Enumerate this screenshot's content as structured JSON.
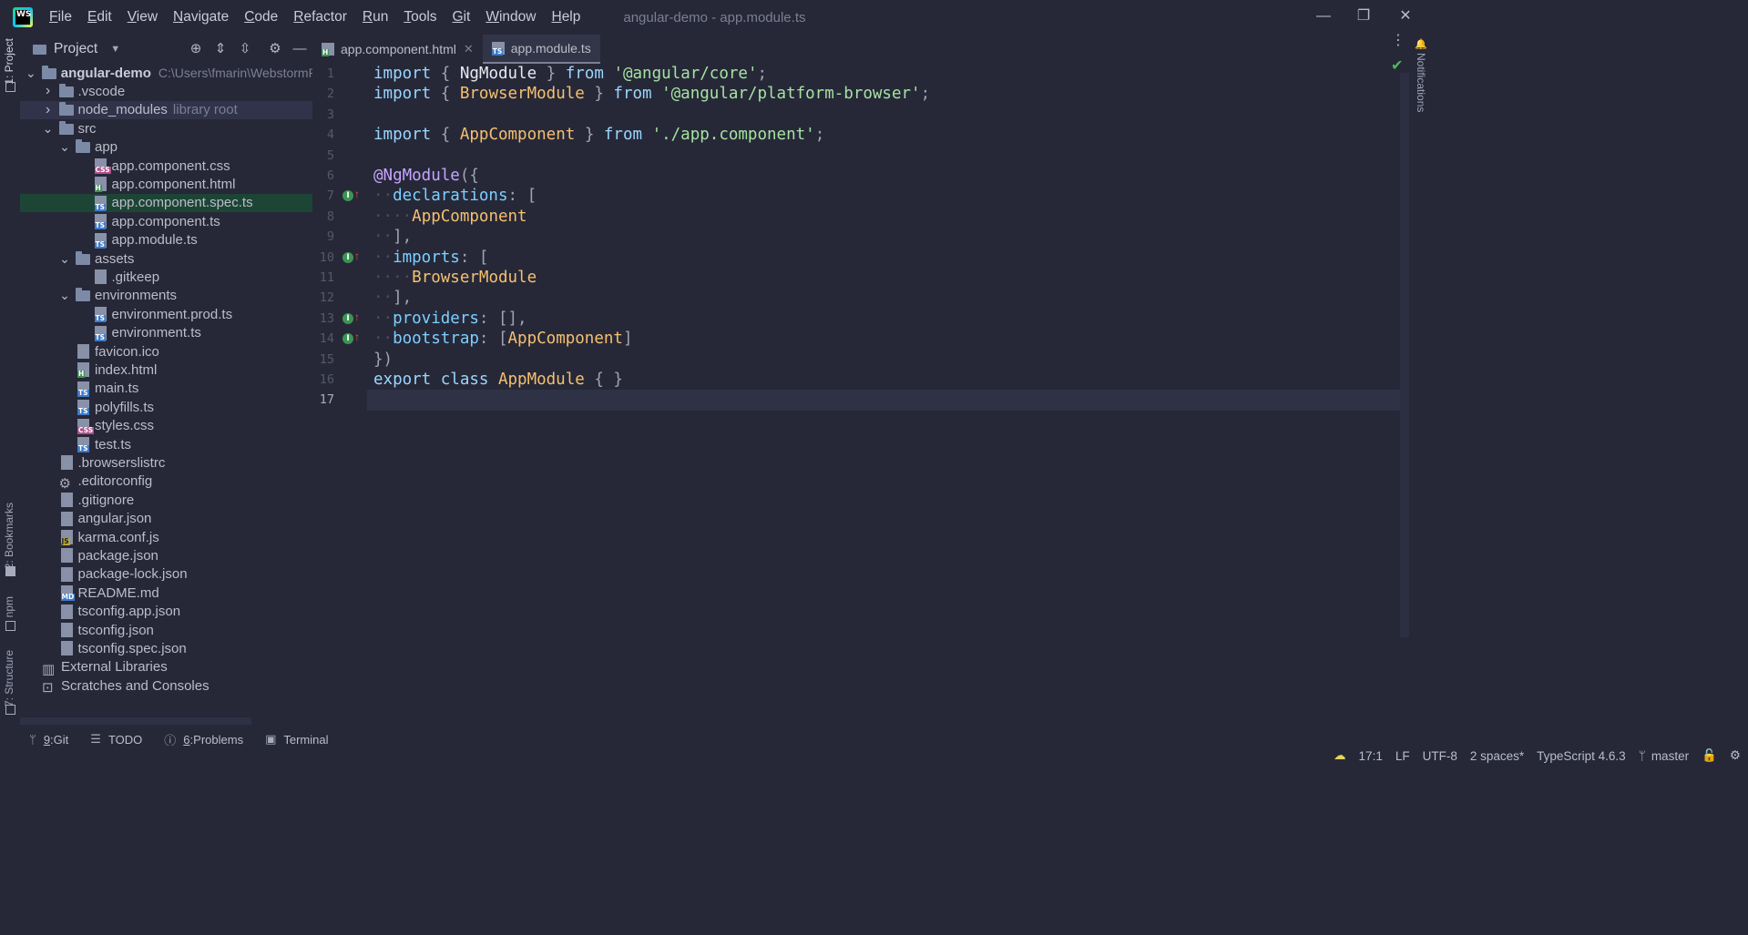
{
  "app": {
    "logo_text": "WS",
    "window_title": "angular-demo - app.module.ts"
  },
  "menu": [
    {
      "label": "File"
    },
    {
      "label": "Edit"
    },
    {
      "label": "View"
    },
    {
      "label": "Navigate"
    },
    {
      "label": "Code"
    },
    {
      "label": "Refactor"
    },
    {
      "label": "Run"
    },
    {
      "label": "Tools"
    },
    {
      "label": "Git"
    },
    {
      "label": "Window"
    },
    {
      "label": "Help"
    }
  ],
  "left_strip": {
    "project": "1: Project",
    "bookmarks": "2: Bookmarks",
    "npm": "npm",
    "structure": "7: Structure"
  },
  "right_strip": {
    "notifications": "Notifications"
  },
  "project_panel": {
    "title": "Project",
    "tree": [
      {
        "label": "angular-demo",
        "extra": "C:\\Users\\fmarin\\WebstormProjects\\",
        "depth": 0,
        "kind": "folder",
        "expanded": true,
        "bold": true
      },
      {
        "label": ".vscode",
        "depth": 1,
        "kind": "folder",
        "expanded": false
      },
      {
        "label": "node_modules",
        "extra": "library root",
        "depth": 1,
        "kind": "folder",
        "expanded": false,
        "highlight": "gray"
      },
      {
        "label": "src",
        "depth": 1,
        "kind": "folder",
        "expanded": true
      },
      {
        "label": "app",
        "depth": 2,
        "kind": "folder",
        "expanded": true
      },
      {
        "label": "app.component.css",
        "depth": 3,
        "kind": "file",
        "badge": "CSS"
      },
      {
        "label": "app.component.html",
        "depth": 3,
        "kind": "file",
        "badge": "H"
      },
      {
        "label": "app.component.spec.ts",
        "depth": 3,
        "kind": "file",
        "badge": "TS",
        "highlight": "green"
      },
      {
        "label": "app.component.ts",
        "depth": 3,
        "kind": "file",
        "badge": "TS"
      },
      {
        "label": "app.module.ts",
        "depth": 3,
        "kind": "file",
        "badge": "TS"
      },
      {
        "label": "assets",
        "depth": 2,
        "kind": "folder",
        "expanded": true
      },
      {
        "label": ".gitkeep",
        "depth": 3,
        "kind": "file",
        "badge": ""
      },
      {
        "label": "environments",
        "depth": 2,
        "kind": "folder",
        "expanded": true
      },
      {
        "label": "environment.prod.ts",
        "depth": 3,
        "kind": "file",
        "badge": "TS"
      },
      {
        "label": "environment.ts",
        "depth": 3,
        "kind": "file",
        "badge": "TS"
      },
      {
        "label": "favicon.ico",
        "depth": 2,
        "kind": "file",
        "badge": ""
      },
      {
        "label": "index.html",
        "depth": 2,
        "kind": "file",
        "badge": "H"
      },
      {
        "label": "main.ts",
        "depth": 2,
        "kind": "file",
        "badge": "TS"
      },
      {
        "label": "polyfills.ts",
        "depth": 2,
        "kind": "file",
        "badge": "TS"
      },
      {
        "label": "styles.css",
        "depth": 2,
        "kind": "file",
        "badge": "CSS"
      },
      {
        "label": "test.ts",
        "depth": 2,
        "kind": "file",
        "badge": "TS"
      },
      {
        "label": ".browserslistrc",
        "depth": 1,
        "kind": "file",
        "badge": ""
      },
      {
        "label": ".editorconfig",
        "depth": 1,
        "kind": "gear",
        "badge": ""
      },
      {
        "label": ".gitignore",
        "depth": 1,
        "kind": "file",
        "badge": ""
      },
      {
        "label": "angular.json",
        "depth": 1,
        "kind": "file",
        "badge": ""
      },
      {
        "label": "karma.conf.js",
        "depth": 1,
        "kind": "file",
        "badge": "JS"
      },
      {
        "label": "package.json",
        "depth": 1,
        "kind": "file",
        "badge": ""
      },
      {
        "label": "package-lock.json",
        "depth": 1,
        "kind": "file",
        "badge": ""
      },
      {
        "label": "README.md",
        "depth": 1,
        "kind": "file",
        "badge": "MD"
      },
      {
        "label": "tsconfig.app.json",
        "depth": 1,
        "kind": "file",
        "badge": ""
      },
      {
        "label": "tsconfig.json",
        "depth": 1,
        "kind": "file",
        "badge": ""
      },
      {
        "label": "tsconfig.spec.json",
        "depth": 1,
        "kind": "file",
        "badge": ""
      },
      {
        "label": "External Libraries",
        "depth": 0,
        "kind": "libs",
        "expanded": false
      },
      {
        "label": "Scratches and Consoles",
        "depth": 0,
        "kind": "scratch",
        "expanded": false
      }
    ]
  },
  "editor": {
    "tabs": [
      {
        "label": "app.component.html",
        "badge": "H",
        "active": false
      },
      {
        "label": "app.module.ts",
        "badge": "TS",
        "active": true
      }
    ],
    "lines": [
      [
        [
          "kw",
          "import "
        ],
        [
          "pun",
          "{ "
        ],
        [
          "id",
          "NgModule"
        ],
        [
          "pun",
          " } "
        ],
        [
          "kw",
          "from "
        ],
        [
          "str",
          "'@angular/core'"
        ],
        [
          "pun",
          ";"
        ]
      ],
      [
        [
          "kw",
          "import "
        ],
        [
          "pun",
          "{ "
        ],
        [
          "cls",
          "BrowserModule"
        ],
        [
          "pun",
          " } "
        ],
        [
          "kw",
          "from "
        ],
        [
          "str",
          "'@angular/platform-browser'"
        ],
        [
          "pun",
          ";"
        ]
      ],
      [],
      [
        [
          "kw",
          "import "
        ],
        [
          "pun",
          "{ "
        ],
        [
          "cls",
          "AppComponent"
        ],
        [
          "pun",
          " } "
        ],
        [
          "kw",
          "from "
        ],
        [
          "str",
          "'./app.component'"
        ],
        [
          "pun",
          ";"
        ]
      ],
      [],
      [
        [
          "dec",
          "@NgModule"
        ],
        [
          "pun",
          "({"
        ]
      ],
      [
        [
          "dot",
          "··"
        ],
        [
          "prop",
          "declarations"
        ],
        [
          "pun",
          ": ["
        ]
      ],
      [
        [
          "dot",
          "····"
        ],
        [
          "cls",
          "AppComponent"
        ]
      ],
      [
        [
          "dot",
          "··"
        ],
        [
          "pun",
          "],"
        ]
      ],
      [
        [
          "dot",
          "··"
        ],
        [
          "prop",
          "imports"
        ],
        [
          "pun",
          ": ["
        ]
      ],
      [
        [
          "dot",
          "····"
        ],
        [
          "cls",
          "BrowserModule"
        ]
      ],
      [
        [
          "dot",
          "··"
        ],
        [
          "pun",
          "],"
        ]
      ],
      [
        [
          "dot",
          "··"
        ],
        [
          "prop",
          "providers"
        ],
        [
          "pun",
          ": [],"
        ]
      ],
      [
        [
          "dot",
          "··"
        ],
        [
          "prop",
          "bootstrap"
        ],
        [
          "pun",
          ": ["
        ],
        [
          "cls",
          "AppComponent"
        ],
        [
          "pun",
          "]"
        ]
      ],
      [
        [
          "pun",
          "})"
        ]
      ],
      [
        [
          "kw",
          "export class "
        ],
        [
          "cls",
          "AppModule"
        ],
        [
          "pun",
          " { }"
        ]
      ],
      []
    ],
    "line_numbers": [
      "1",
      "2",
      "3",
      "4",
      "5",
      "6",
      "7",
      "8",
      "9",
      "10",
      "11",
      "12",
      "13",
      "14",
      "15",
      "16",
      "17"
    ],
    "current_line": 17,
    "gutter_marks": [
      7,
      10,
      13,
      14
    ],
    "gutter_mark_glyph": "I",
    "gutter_arrow_glyph": "↑"
  },
  "bottom_tools": [
    {
      "label": "Git",
      "prefix": "9",
      "icon": "git-icon"
    },
    {
      "label": "TODO",
      "prefix": "",
      "icon": "todo-icon"
    },
    {
      "label": "Problems",
      "prefix": "6",
      "icon": "problems-icon"
    },
    {
      "label": "Terminal",
      "prefix": "",
      "icon": "terminal-icon"
    }
  ],
  "status": {
    "position": "17:1",
    "line_sep": "LF",
    "encoding": "UTF-8",
    "indent": "2 spaces*",
    "language": "TypeScript 4.6.3",
    "branch": "master"
  },
  "colors": {
    "background": "#262838",
    "selection_green": "#1d4535",
    "keyword": "#9ad6ff",
    "class": "#f5c06f",
    "string": "#a6e3a1"
  }
}
